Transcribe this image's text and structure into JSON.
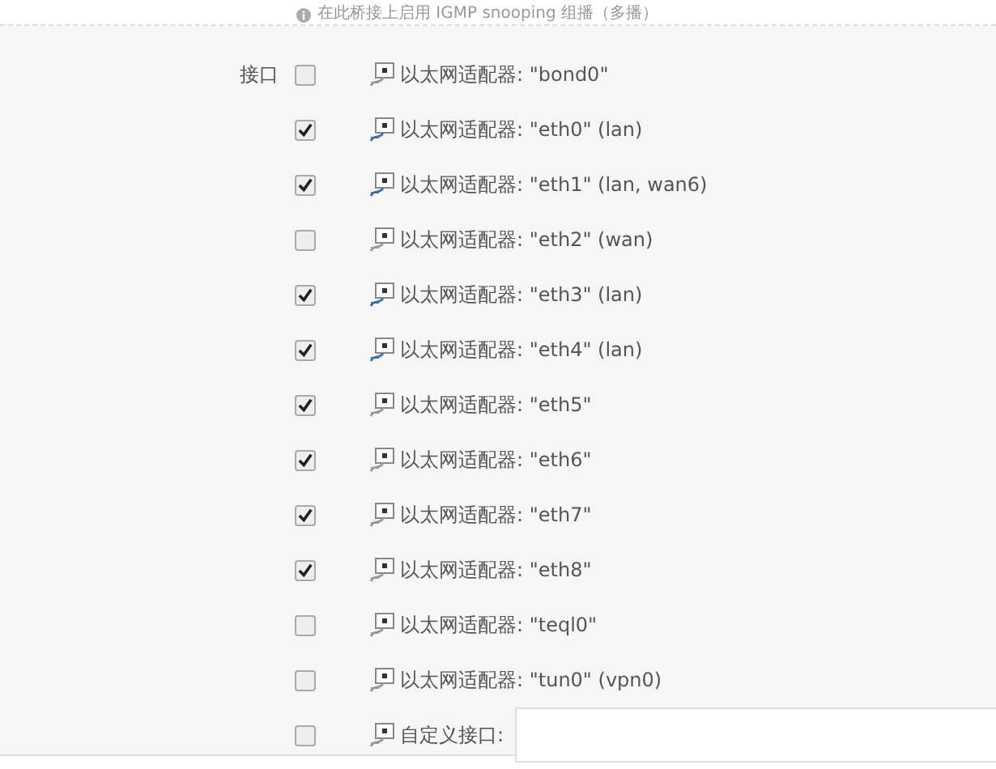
{
  "hint": {
    "text": "在此桥接上启用 IGMP snooping 组播（多播）"
  },
  "field_label": "接口",
  "interfaces": [
    {
      "kind": "adapter",
      "label": "以太网适配器: \"bond0\"",
      "checked": false,
      "connected": false
    },
    {
      "kind": "adapter",
      "label": "以太网适配器: \"eth0\" (lan)",
      "checked": true,
      "connected": true
    },
    {
      "kind": "adapter",
      "label": "以太网适配器: \"eth1\" (lan, wan6)",
      "checked": true,
      "connected": true
    },
    {
      "kind": "adapter",
      "label": "以太网适配器: \"eth2\" (wan)",
      "checked": false,
      "connected": false
    },
    {
      "kind": "adapter",
      "label": "以太网适配器: \"eth3\" (lan)",
      "checked": true,
      "connected": true
    },
    {
      "kind": "adapter",
      "label": "以太网适配器: \"eth4\" (lan)",
      "checked": true,
      "connected": true
    },
    {
      "kind": "adapter",
      "label": "以太网适配器: \"eth5\"",
      "checked": true,
      "connected": false
    },
    {
      "kind": "adapter",
      "label": "以太网适配器: \"eth6\"",
      "checked": true,
      "connected": false
    },
    {
      "kind": "adapter",
      "label": "以太网适配器: \"eth7\"",
      "checked": true,
      "connected": false
    },
    {
      "kind": "adapter",
      "label": "以太网适配器: \"eth8\"",
      "checked": true,
      "connected": false
    },
    {
      "kind": "adapter",
      "label": "以太网适配器: \"teql0\"",
      "checked": false,
      "connected": false
    },
    {
      "kind": "adapter",
      "label": "以太网适配器: \"tun0\" (vpn0)",
      "checked": false,
      "connected": false
    },
    {
      "kind": "custom",
      "label": "自定义接口:",
      "checked": false,
      "connected": false
    }
  ]
}
